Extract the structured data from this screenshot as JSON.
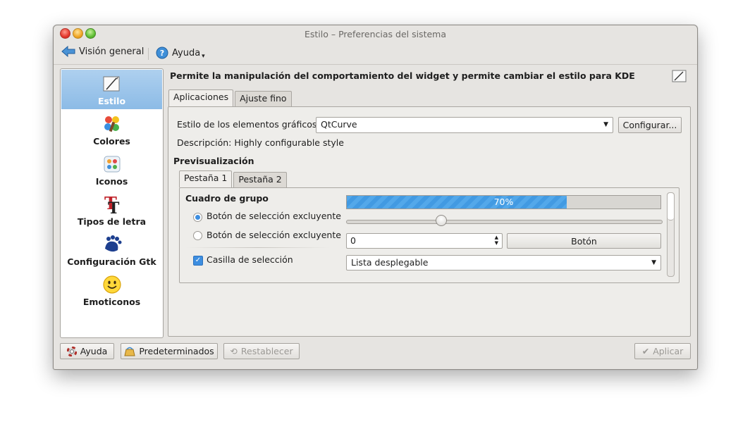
{
  "window": {
    "title": "Estilo – Preferencias del sistema"
  },
  "toolbar": {
    "overview_label": "Visión general",
    "help_label": "Ayuda"
  },
  "sidebar": {
    "items": [
      {
        "label": "Estilo",
        "icon": "style-icon",
        "selected": true
      },
      {
        "label": "Colores",
        "icon": "colors-icon"
      },
      {
        "label": "Iconos",
        "icon": "icons-icon"
      },
      {
        "label": "Tipos de letra",
        "icon": "fonts-icon"
      },
      {
        "label": "Configuración Gtk",
        "icon": "gtk-icon"
      },
      {
        "label": "Emoticonos",
        "icon": "emoticons-icon"
      }
    ]
  },
  "main": {
    "header": "Permite la manipulación del comportamiento del widget y permite cambiar el estilo para KDE",
    "tabs": [
      "Aplicaciones",
      "Ajuste fino"
    ],
    "widget_style_label": "Estilo de los elementos gráficos:",
    "widget_style_value": "QtCurve",
    "configure_button": "Configurar...",
    "description": "Descripción: Highly configurable style",
    "preview_heading": "Previsualización",
    "preview_tabs": [
      "Pestaña 1",
      "Pestaña 2"
    ],
    "preview": {
      "group_box_title": "Cuadro de grupo",
      "radio1_label": "Botón de selección excluyente",
      "radio2_label": "Botón de selección excluyente",
      "checkbox_label": "Casilla de selección",
      "progress_text": "70%",
      "progress_value": 0.7,
      "slider_value": 0.3,
      "spin_value": "0",
      "button_label": "Botón",
      "combo_value": "Lista desplegable"
    }
  },
  "footer": {
    "help_button": "Ayuda",
    "defaults_button": "Predeterminados",
    "reset_button": "Restablecer",
    "apply_button": "Aplicar"
  },
  "colors": {
    "selection": "#8cbbe6",
    "progress": "#4aa0e6",
    "check_accent": "#3d8ee0"
  }
}
